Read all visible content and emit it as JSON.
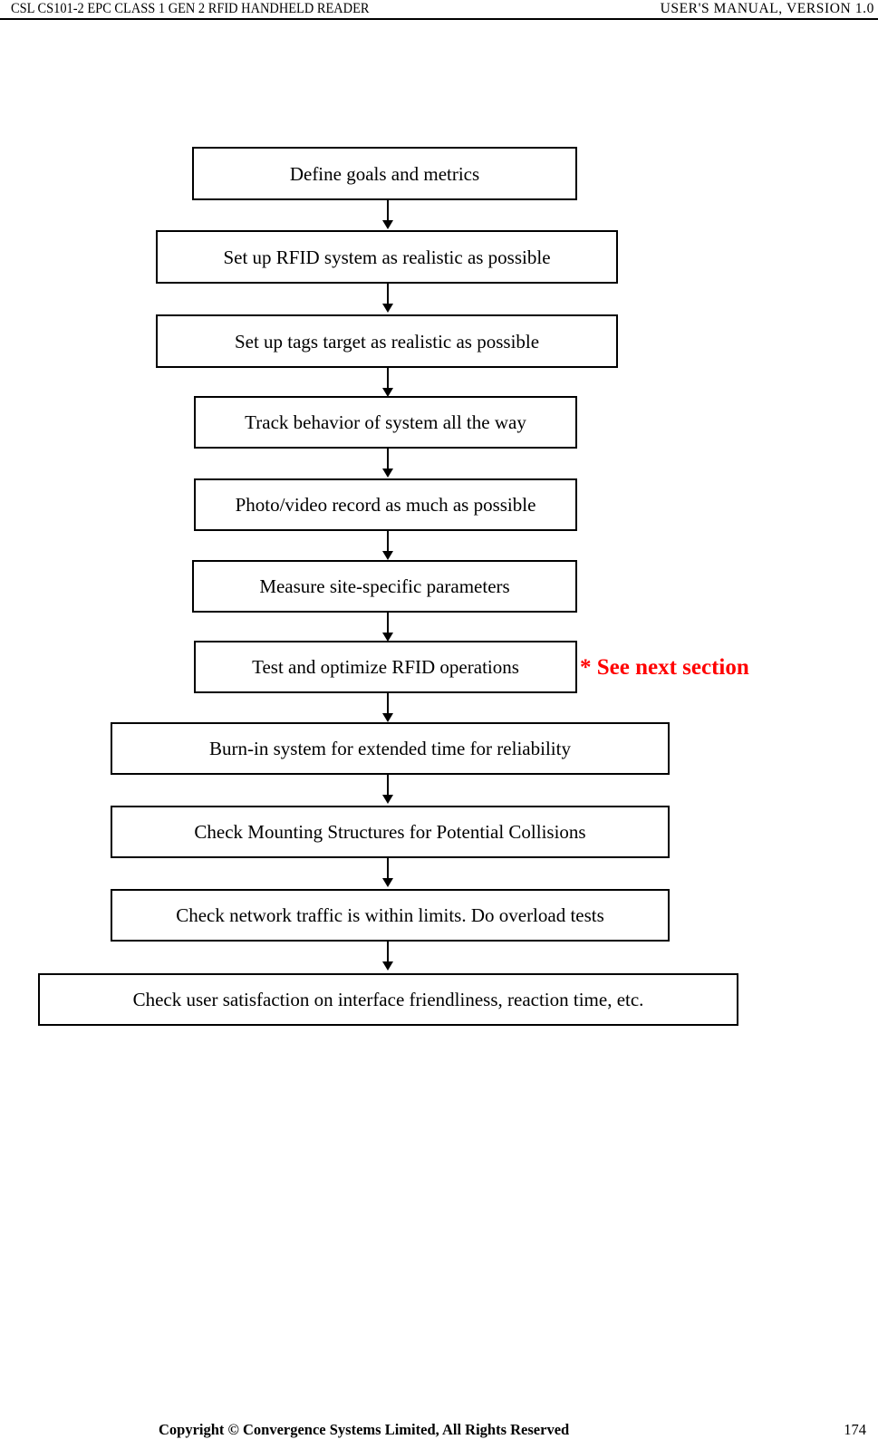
{
  "header": {
    "left_text": "CSL CS101-2 EPC CLASS 1 GEN 2 RFID HANDHELD READER",
    "right_text": "USER'S  MANUAL,  VERSION  1.0"
  },
  "flowchart": {
    "annotation": {
      "text": "* See next section",
      "color": "#FF0000"
    },
    "boxes": [
      {
        "label": "Define goals and metrics"
      },
      {
        "label": "Set up RFID system as realistic as possible"
      },
      {
        "label": "Set up tags target as realistic as possible"
      },
      {
        "label": "Track behavior of system all the way"
      },
      {
        "label": "Photo/video record as much as possible"
      },
      {
        "label": "Measure site-specific parameters"
      },
      {
        "label": "Test and optimize RFID operations"
      },
      {
        "label": "Burn-in system for extended time for reliability"
      },
      {
        "label": "Check Mounting Structures for Potential Collisions"
      },
      {
        "label": "Check network traffic is within limits. Do overload tests"
      },
      {
        "label": "Check user satisfaction on interface friendliness, reaction time, etc."
      }
    ]
  },
  "footer": {
    "copyright": "Copyright © Convergence Systems Limited, All Rights Reserved",
    "page_number": "174"
  }
}
